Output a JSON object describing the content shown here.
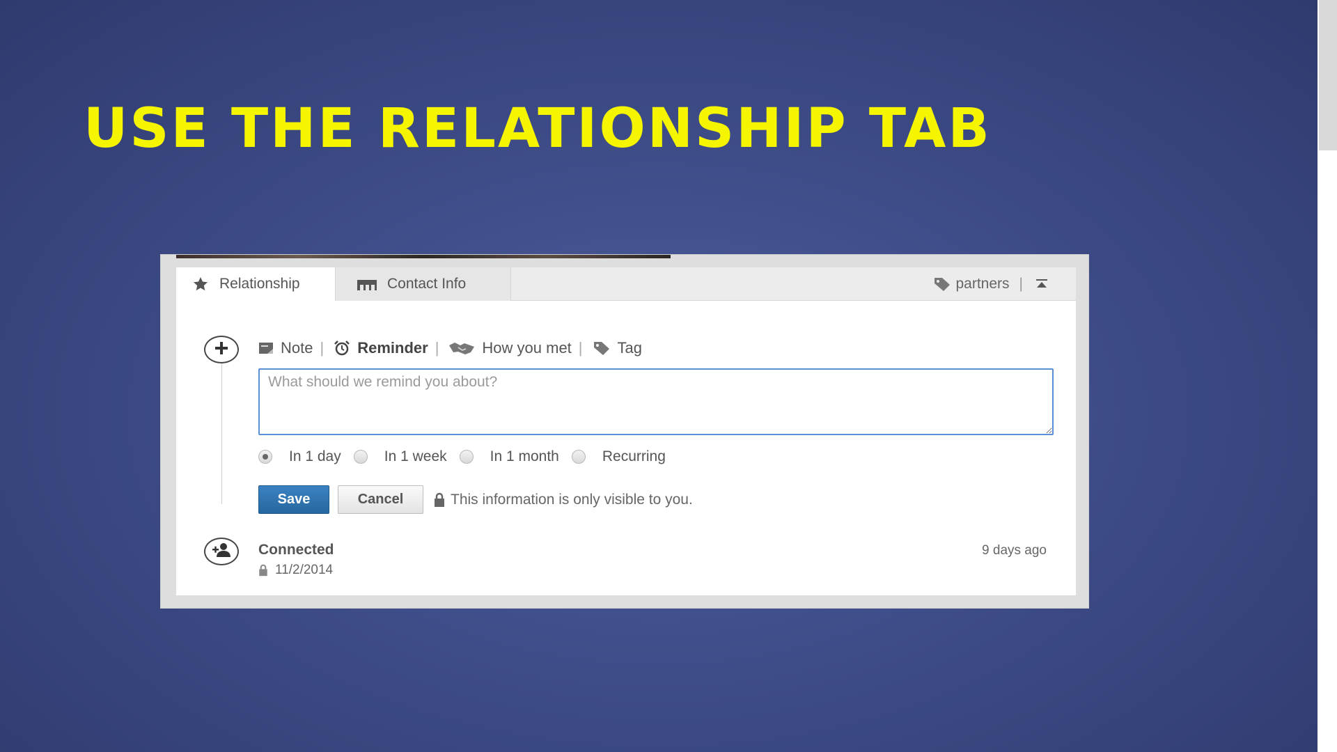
{
  "slide": {
    "title": "USE THE RELATIONSHIP TAB"
  },
  "tabs": [
    {
      "label": "Relationship",
      "icon": "star-icon",
      "active": true
    },
    {
      "label": "Contact Info",
      "icon": "id-card-icon",
      "active": false
    }
  ],
  "tag_area": {
    "tag_label": "partners",
    "separator": "|"
  },
  "actions": [
    {
      "label": "Note",
      "icon": "note-icon"
    },
    {
      "label": "Reminder",
      "icon": "alarm-clock-icon",
      "selected": true
    },
    {
      "label": "How you met",
      "icon": "handshake-icon"
    },
    {
      "label": "Tag",
      "icon": "tag-icon"
    }
  ],
  "action_separator": "|",
  "reminder": {
    "placeholder": "What should we remind you about?",
    "value": ""
  },
  "timing_options": [
    {
      "label": "In 1 day",
      "checked": true
    },
    {
      "label": "In 1 week",
      "checked": false
    },
    {
      "label": "In 1 month",
      "checked": false
    },
    {
      "label": "Recurring",
      "checked": false
    }
  ],
  "buttons": {
    "save": "Save",
    "cancel": "Cancel"
  },
  "privacy_note": "This information is only visible to you.",
  "connection": {
    "title": "Connected",
    "date": "11/2/2014",
    "relative_time": "9 days ago"
  },
  "colors": {
    "title": "#f5f500",
    "slide_background": "#3e4c88",
    "save_button": "#2f75b5",
    "input_border": "#5b8fd6"
  }
}
